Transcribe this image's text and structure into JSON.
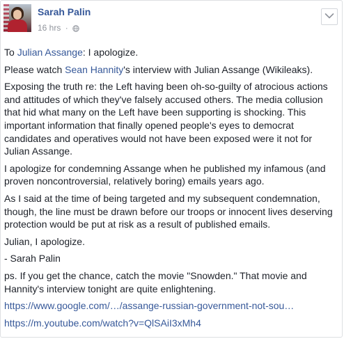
{
  "post": {
    "author": "Sarah Palin",
    "time": "16 hrs",
    "separator": "·",
    "privacy_icon": "globe-icon",
    "menu_icon": "chevron-down-icon",
    "paragraphs": {
      "p1": {
        "prefix": "To ",
        "link": "Julian Assange",
        "suffix": ": I apologize."
      },
      "p2": {
        "prefix": "Please watch ",
        "link": "Sean Hannity",
        "suffix": "'s interview with Julian Assange (Wikileaks)."
      },
      "p3": "Exposing the truth re: the Left having been oh-so-guilty of atrocious actions and attitudes of which they've falsely accused others. The media collusion that hid what many on the Left have been supporting is shocking. This important information that finally opened people's eyes to democrat candidates and operatives would not have been exposed were it not for Julian Assange.",
      "p4": "I apologize for condemning Assange when he published my infamous (and proven noncontroversial, relatively boring) emails years ago.",
      "p5": "As I said at the time of being targeted and my subsequent condemnation, though, the line must be drawn before our troops or innocent lives deserving protection would be put at risk as a result of published emails.",
      "p6": "Julian, I apologize.",
      "p7": "- Sarah Palin",
      "p8": "ps. If you get the chance, catch the movie \"Snowden.\" That movie and Hannity's interview tonight are quite enlightening.",
      "link1": "https://www.google.com/…/assange-russian-government-not-sou…",
      "link2": "https://m.youtube.com/watch?v=QlSAiI3xMh4"
    }
  },
  "colors": {
    "link": "#365899",
    "text": "#1d2129",
    "meta": "#90949c",
    "border": "#dddfe2"
  }
}
